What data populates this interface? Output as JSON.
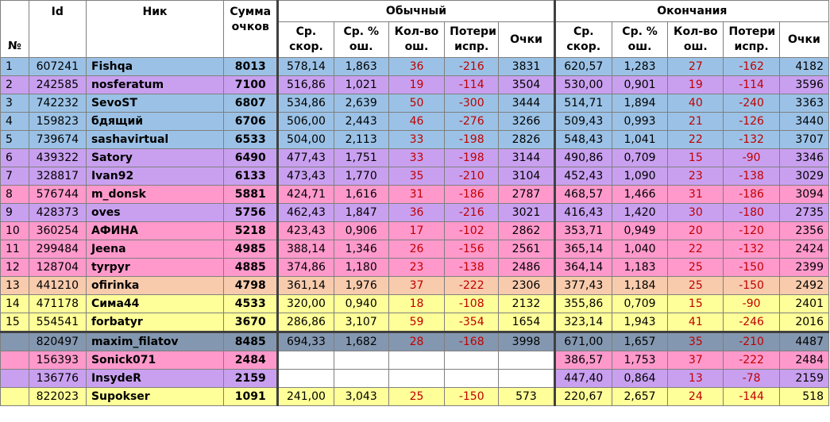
{
  "header": {
    "num": "№",
    "id": "Id",
    "nick": "Ник",
    "sum": "Сумма очков",
    "group_regular": "Обычный",
    "group_endings": "Окончания",
    "avg_speed": "Ср. скор.",
    "avg_err": "Ср. % ош.",
    "err_count": "Кол-во ош.",
    "fix_loss": "Потери испр.",
    "points": "Очки"
  },
  "rows": [
    {
      "num": "1",
      "id": "607241",
      "nick": "Fishqa",
      "sum": "8013",
      "r_speed": "578,14",
      "r_err": "1,863",
      "r_cnt": "36",
      "r_loss": "-216",
      "r_pts": "3831",
      "e_speed": "620,57",
      "e_err": "1,283",
      "e_cnt": "27",
      "e_loss": "-162",
      "e_pts": "4182",
      "color": "blue"
    },
    {
      "num": "2",
      "id": "242585",
      "nick": "nosferatum",
      "sum": "7100",
      "r_speed": "516,86",
      "r_err": "1,021",
      "r_cnt": "19",
      "r_loss": "-114",
      "r_pts": "3504",
      "e_speed": "530,00",
      "e_err": "0,901",
      "e_cnt": "19",
      "e_loss": "-114",
      "e_pts": "3596",
      "color": "purple"
    },
    {
      "num": "3",
      "id": "742232",
      "nick": "SevoST",
      "sum": "6807",
      "r_speed": "534,86",
      "r_err": "2,639",
      "r_cnt": "50",
      "r_loss": "-300",
      "r_pts": "3444",
      "e_speed": "514,71",
      "e_err": "1,894",
      "e_cnt": "40",
      "e_loss": "-240",
      "e_pts": "3363",
      "color": "blue"
    },
    {
      "num": "4",
      "id": "159823",
      "nick": "бдящий",
      "sum": "6706",
      "r_speed": "506,00",
      "r_err": "2,443",
      "r_cnt": "46",
      "r_loss": "-276",
      "r_pts": "3266",
      "e_speed": "509,43",
      "e_err": "0,993",
      "e_cnt": "21",
      "e_loss": "-126",
      "e_pts": "3440",
      "color": "blue"
    },
    {
      "num": "5",
      "id": "739674",
      "nick": "sashavirtual",
      "sum": "6533",
      "r_speed": "504,00",
      "r_err": "2,113",
      "r_cnt": "33",
      "r_loss": "-198",
      "r_pts": "2826",
      "e_speed": "548,43",
      "e_err": "1,041",
      "e_cnt": "22",
      "e_loss": "-132",
      "e_pts": "3707",
      "color": "blue"
    },
    {
      "num": "6",
      "id": "439322",
      "nick": "Satory",
      "sum": "6490",
      "r_speed": "477,43",
      "r_err": "1,751",
      "r_cnt": "33",
      "r_loss": "-198",
      "r_pts": "3144",
      "e_speed": "490,86",
      "e_err": "0,709",
      "e_cnt": "15",
      "e_loss": "-90",
      "e_pts": "3346",
      "color": "purple"
    },
    {
      "num": "7",
      "id": "328817",
      "nick": "Ivan92",
      "sum": "6133",
      "r_speed": "473,43",
      "r_err": "1,770",
      "r_cnt": "35",
      "r_loss": "-210",
      "r_pts": "3104",
      "e_speed": "452,43",
      "e_err": "1,090",
      "e_cnt": "23",
      "e_loss": "-138",
      "e_pts": "3029",
      "color": "purple"
    },
    {
      "num": "8",
      "id": "576744",
      "nick": "m_donsk",
      "sum": "5881",
      "r_speed": "424,71",
      "r_err": "1,616",
      "r_cnt": "31",
      "r_loss": "-186",
      "r_pts": "2787",
      "e_speed": "468,57",
      "e_err": "1,466",
      "e_cnt": "31",
      "e_loss": "-186",
      "e_pts": "3094",
      "color": "pink"
    },
    {
      "num": "9",
      "id": "428373",
      "nick": "oves",
      "sum": "5756",
      "r_speed": "462,43",
      "r_err": "1,847",
      "r_cnt": "36",
      "r_loss": "-216",
      "r_pts": "3021",
      "e_speed": "416,43",
      "e_err": "1,420",
      "e_cnt": "30",
      "e_loss": "-180",
      "e_pts": "2735",
      "color": "purple"
    },
    {
      "num": "10",
      "id": "360254",
      "nick": "АФИНА",
      "sum": "5218",
      "r_speed": "423,43",
      "r_err": "0,906",
      "r_cnt": "17",
      "r_loss": "-102",
      "r_pts": "2862",
      "e_speed": "353,71",
      "e_err": "0,949",
      "e_cnt": "20",
      "e_loss": "-120",
      "e_pts": "2356",
      "color": "pink"
    },
    {
      "num": "11",
      "id": "299484",
      "nick": "Jeena",
      "sum": "4985",
      "r_speed": "388,14",
      "r_err": "1,346",
      "r_cnt": "26",
      "r_loss": "-156",
      "r_pts": "2561",
      "e_speed": "365,14",
      "e_err": "1,040",
      "e_cnt": "22",
      "e_loss": "-132",
      "e_pts": "2424",
      "color": "pink"
    },
    {
      "num": "12",
      "id": "128704",
      "nick": "tyrpyr",
      "sum": "4885",
      "r_speed": "374,86",
      "r_err": "1,180",
      "r_cnt": "23",
      "r_loss": "-138",
      "r_pts": "2486",
      "e_speed": "364,14",
      "e_err": "1,183",
      "e_cnt": "25",
      "e_loss": "-150",
      "e_pts": "2399",
      "color": "pink"
    },
    {
      "num": "13",
      "id": "441210",
      "nick": "ofirinka",
      "sum": "4798",
      "r_speed": "361,14",
      "r_err": "1,976",
      "r_cnt": "37",
      "r_loss": "-222",
      "r_pts": "2306",
      "e_speed": "377,43",
      "e_err": "1,184",
      "e_cnt": "25",
      "e_loss": "-150",
      "e_pts": "2492",
      "color": "orange"
    },
    {
      "num": "14",
      "id": "471178",
      "nick": "Сима44",
      "sum": "4533",
      "r_speed": "320,00",
      "r_err": "0,940",
      "r_cnt": "18",
      "r_loss": "-108",
      "r_pts": "2132",
      "e_speed": "355,86",
      "e_err": "0,709",
      "e_cnt": "15",
      "e_loss": "-90",
      "e_pts": "2401",
      "color": "yellow"
    },
    {
      "num": "15",
      "id": "554541",
      "nick": "forbatyr",
      "sum": "3670",
      "r_speed": "286,86",
      "r_err": "3,107",
      "r_cnt": "59",
      "r_loss": "-354",
      "r_pts": "1654",
      "e_speed": "323,14",
      "e_err": "1,943",
      "e_cnt": "41",
      "e_loss": "-246",
      "e_pts": "2016",
      "color": "yellow"
    },
    {
      "num": "",
      "id": "820497",
      "nick": "maxim_filatov",
      "sum": "8485",
      "r_speed": "694,33",
      "r_err": "1,682",
      "r_cnt": "28",
      "r_loss": "-168",
      "r_pts": "3998",
      "e_speed": "671,00",
      "e_err": "1,657",
      "e_cnt": "35",
      "e_loss": "-210",
      "e_pts": "4487",
      "color": "dark"
    },
    {
      "num": "",
      "id": "156393",
      "nick": "Sonick071",
      "sum": "2484",
      "r_speed": "",
      "r_err": "",
      "r_cnt": "",
      "r_loss": "",
      "r_pts": "",
      "e_speed": "386,57",
      "e_err": "1,753",
      "e_cnt": "37",
      "e_loss": "-222",
      "e_pts": "2484",
      "color": "pink"
    },
    {
      "num": "",
      "id": "136776",
      "nick": "InsydeR",
      "sum": "2159",
      "r_speed": "",
      "r_err": "",
      "r_cnt": "",
      "r_loss": "",
      "r_pts": "",
      "e_speed": "447,40",
      "e_err": "0,864",
      "e_cnt": "13",
      "e_loss": "-78",
      "e_pts": "2159",
      "color": "purple"
    },
    {
      "num": "",
      "id": "822023",
      "nick": "Supokser",
      "sum": "1091",
      "r_speed": "241,00",
      "r_err": "3,043",
      "r_cnt": "25",
      "r_loss": "-150",
      "r_pts": "573",
      "e_speed": "220,67",
      "e_err": "2,657",
      "e_cnt": "24",
      "e_loss": "-144",
      "e_pts": "518",
      "color": "yellow"
    }
  ]
}
